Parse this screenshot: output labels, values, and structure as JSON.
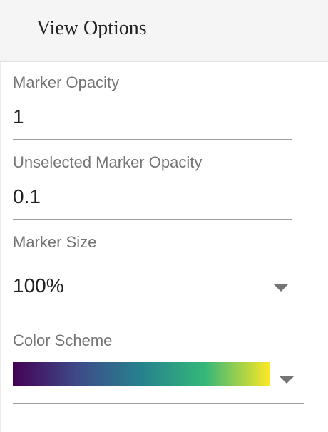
{
  "header": {
    "title": "View Options"
  },
  "fields": {
    "marker_opacity": {
      "label": "Marker Opacity",
      "value": "1"
    },
    "unselected_marker_opacity": {
      "label": "Unselected Marker Opacity",
      "value": "0.1"
    },
    "marker_size": {
      "label": "Marker Size",
      "value": "100%"
    },
    "color_scheme": {
      "label": "Color Scheme",
      "gradient_colors": [
        "#440154",
        "#3e4a89",
        "#26828e",
        "#35b779",
        "#fde725"
      ]
    }
  },
  "icons": {
    "dropdown": "caret-down-icon"
  },
  "colors": {
    "label": "#757575",
    "text": "#212121",
    "underline": "#9e9e9e",
    "header_bg": "#f5f5f5"
  }
}
